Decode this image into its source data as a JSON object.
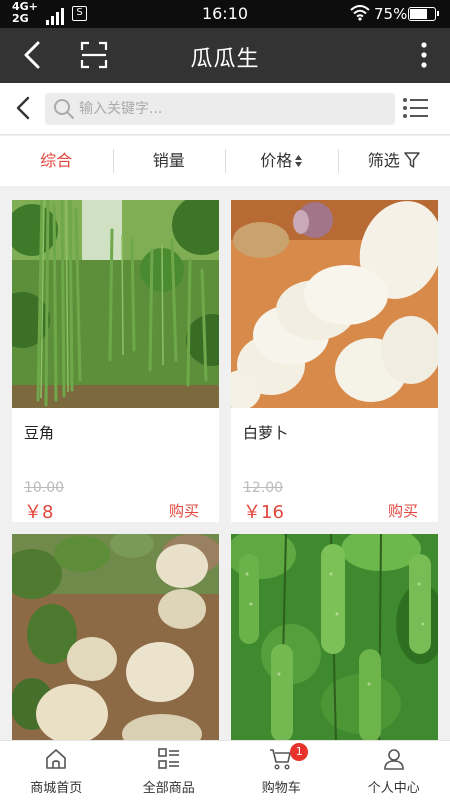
{
  "status_bar": {
    "network_top": "4G+",
    "network_bottom": "2G",
    "time": "16:10",
    "battery": "75%",
    "battery_level": 0.75
  },
  "title_bar": {
    "title": "瓜瓜生",
    "back_icon": "back-arrow-icon",
    "scan_icon": "scan-icon",
    "more_icon": "more-vertical-icon"
  },
  "search": {
    "placeholder": "输入关键字..."
  },
  "sort": {
    "items": [
      {
        "label": "综合",
        "active": true
      },
      {
        "label": "销量"
      },
      {
        "label": "价格"
      },
      {
        "label": "筛选"
      }
    ],
    "active_color": "#e2463c"
  },
  "products": [
    {
      "name": "豆角",
      "old_price": "10.00",
      "price": "￥8",
      "buy": "购买",
      "image": "long-beans-photo"
    },
    {
      "name": "白萝卜",
      "old_price": "12.00",
      "price": "￥16",
      "buy": "购买",
      "image": "white-radish-photo"
    },
    {
      "name": "",
      "old_price": "",
      "price": "",
      "buy": "",
      "image": "potatoes-photo"
    },
    {
      "name": "",
      "old_price": "",
      "price": "",
      "buy": "",
      "image": "cucumbers-photo"
    }
  ],
  "bottom_nav": {
    "items": [
      {
        "label": "商城首页",
        "icon": "home-icon"
      },
      {
        "label": "全部商品",
        "icon": "grid-list-icon"
      },
      {
        "label": "购物车",
        "icon": "cart-icon",
        "badge": "1"
      },
      {
        "label": "个人中心",
        "icon": "user-icon"
      }
    ]
  }
}
